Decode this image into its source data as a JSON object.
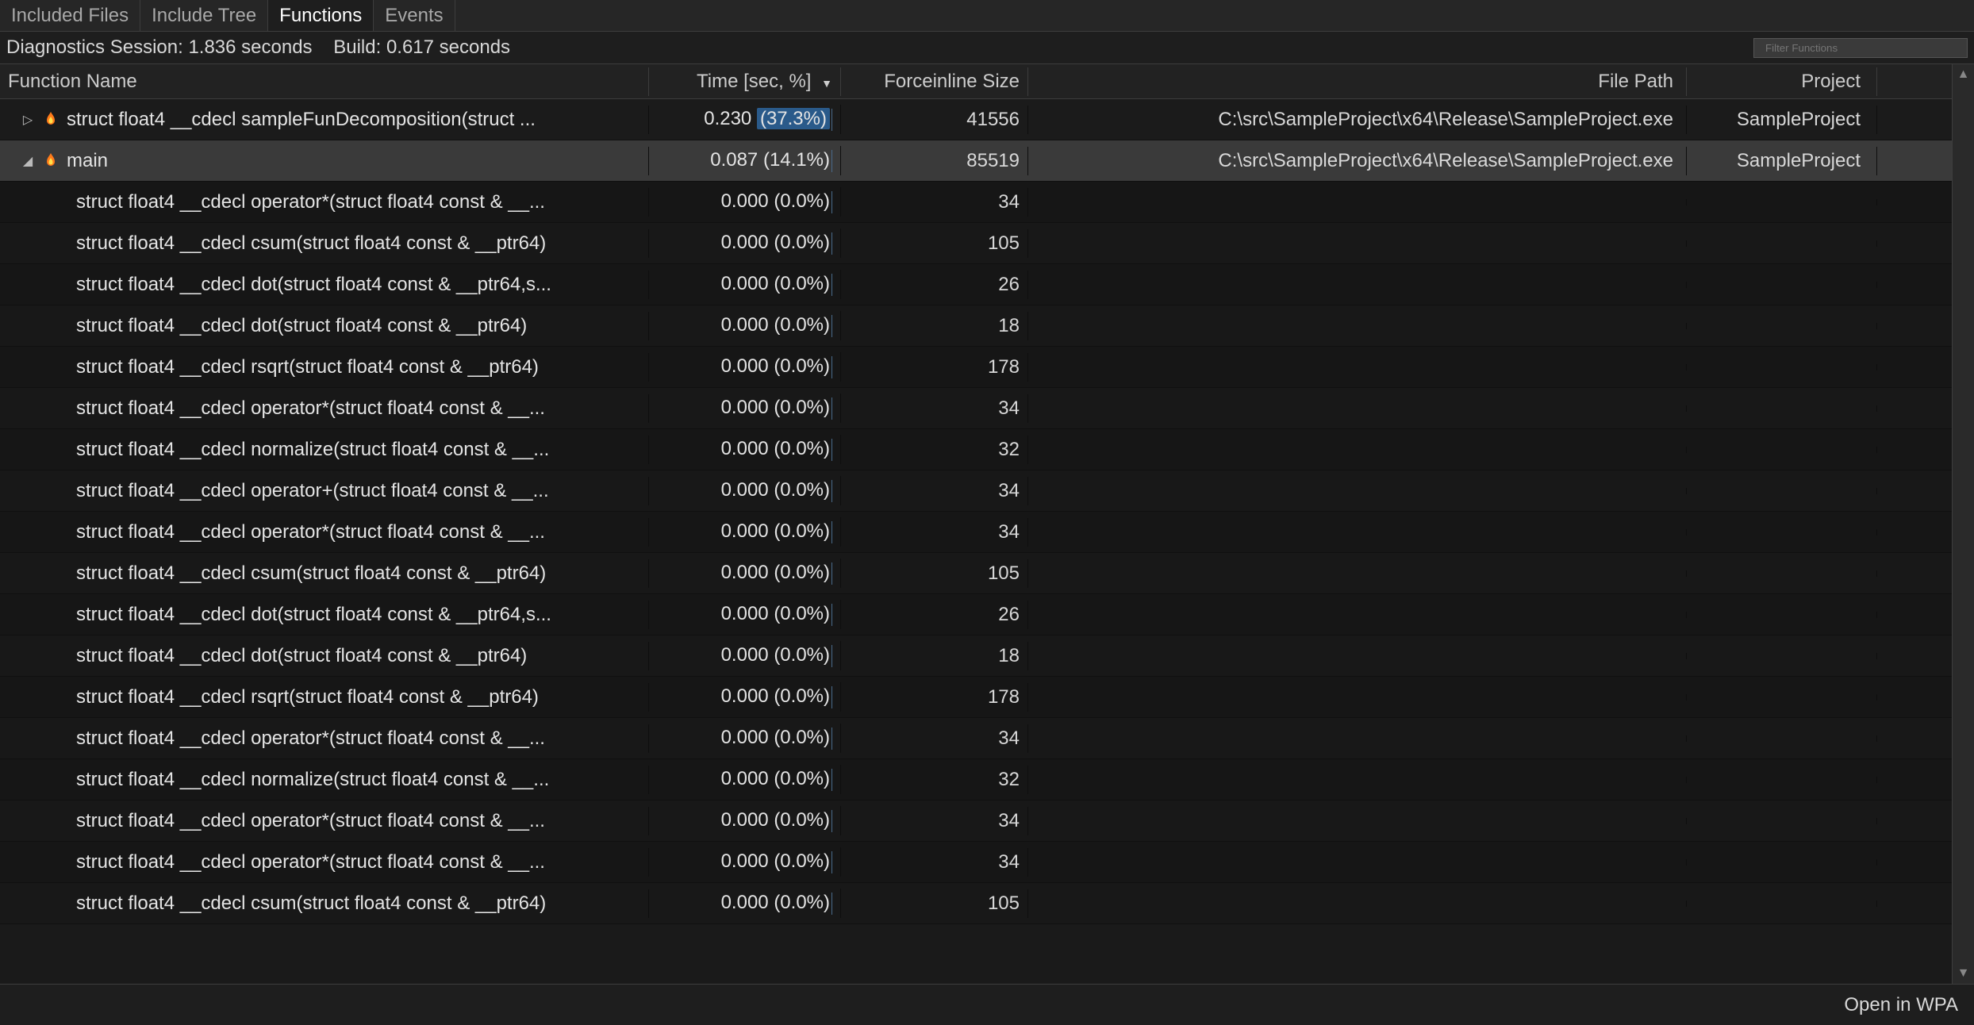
{
  "tabs": {
    "items": [
      {
        "label": "Included Files",
        "active": false
      },
      {
        "label": "Include Tree",
        "active": false
      },
      {
        "label": "Functions",
        "active": true
      },
      {
        "label": "Events",
        "active": false
      }
    ]
  },
  "infobar": {
    "session_label": "Diagnostics Session: 1.836 seconds",
    "build_label": "Build: 0.617 seconds",
    "filter_placeholder": "Filter Functions"
  },
  "columns": {
    "name": "Function Name",
    "time": "Time [sec, %]",
    "size": "Forceinline Size",
    "path": "File Path",
    "proj": "Project"
  },
  "rows": [
    {
      "level": 0,
      "expander": "▷",
      "flame": true,
      "name": "struct float4 __cdecl sampleFunDecomposition(struct ...",
      "time_sec": "0.230",
      "time_pct": "(37.3%)",
      "pct_hl": true,
      "size": "41556",
      "path": "C:\\src\\SampleProject\\x64\\Release\\SampleProject.exe",
      "project": "SampleProject"
    },
    {
      "level": 0,
      "expander": "◢",
      "flame": true,
      "selected": true,
      "name": "main",
      "time_sec": "0.087",
      "time_pct": "(14.1%)",
      "size": "85519",
      "path": "C:\\src\\SampleProject\\x64\\Release\\SampleProject.exe",
      "project": "SampleProject"
    },
    {
      "level": 1,
      "name": "struct float4 __cdecl operator*(struct float4 const & __...",
      "time_sec": "0.000",
      "time_pct": "(0.0%)",
      "size": "34",
      "path": "",
      "project": ""
    },
    {
      "level": 1,
      "name": "struct float4 __cdecl csum(struct float4 const & __ptr64)",
      "time_sec": "0.000",
      "time_pct": "(0.0%)",
      "size": "105",
      "path": "",
      "project": ""
    },
    {
      "level": 1,
      "name": "struct float4 __cdecl dot(struct float4 const & __ptr64,s...",
      "time_sec": "0.000",
      "time_pct": "(0.0%)",
      "size": "26",
      "path": "",
      "project": ""
    },
    {
      "level": 1,
      "name": "struct float4 __cdecl dot(struct float4 const & __ptr64)",
      "time_sec": "0.000",
      "time_pct": "(0.0%)",
      "size": "18",
      "path": "",
      "project": ""
    },
    {
      "level": 1,
      "name": "struct float4 __cdecl rsqrt(struct float4 const & __ptr64)",
      "time_sec": "0.000",
      "time_pct": "(0.0%)",
      "size": "178",
      "path": "",
      "project": ""
    },
    {
      "level": 1,
      "name": "struct float4 __cdecl operator*(struct float4 const & __...",
      "time_sec": "0.000",
      "time_pct": "(0.0%)",
      "size": "34",
      "path": "",
      "project": ""
    },
    {
      "level": 1,
      "name": "struct float4 __cdecl normalize(struct float4 const & __...",
      "time_sec": "0.000",
      "time_pct": "(0.0%)",
      "size": "32",
      "path": "",
      "project": ""
    },
    {
      "level": 1,
      "name": "struct float4 __cdecl operator+(struct float4 const & __...",
      "time_sec": "0.000",
      "time_pct": "(0.0%)",
      "size": "34",
      "path": "",
      "project": ""
    },
    {
      "level": 1,
      "name": "struct float4 __cdecl operator*(struct float4 const & __...",
      "time_sec": "0.000",
      "time_pct": "(0.0%)",
      "size": "34",
      "path": "",
      "project": ""
    },
    {
      "level": 1,
      "name": "struct float4 __cdecl csum(struct float4 const & __ptr64)",
      "time_sec": "0.000",
      "time_pct": "(0.0%)",
      "size": "105",
      "path": "",
      "project": ""
    },
    {
      "level": 1,
      "name": "struct float4 __cdecl dot(struct float4 const & __ptr64,s...",
      "time_sec": "0.000",
      "time_pct": "(0.0%)",
      "size": "26",
      "path": "",
      "project": ""
    },
    {
      "level": 1,
      "name": "struct float4 __cdecl dot(struct float4 const & __ptr64)",
      "time_sec": "0.000",
      "time_pct": "(0.0%)",
      "size": "18",
      "path": "",
      "project": ""
    },
    {
      "level": 1,
      "name": "struct float4 __cdecl rsqrt(struct float4 const & __ptr64)",
      "time_sec": "0.000",
      "time_pct": "(0.0%)",
      "size": "178",
      "path": "",
      "project": ""
    },
    {
      "level": 1,
      "name": "struct float4 __cdecl operator*(struct float4 const & __...",
      "time_sec": "0.000",
      "time_pct": "(0.0%)",
      "size": "34",
      "path": "",
      "project": ""
    },
    {
      "level": 1,
      "name": "struct float4 __cdecl normalize(struct float4 const & __...",
      "time_sec": "0.000",
      "time_pct": "(0.0%)",
      "size": "32",
      "path": "",
      "project": ""
    },
    {
      "level": 1,
      "name": "struct float4 __cdecl operator*(struct float4 const & __...",
      "time_sec": "0.000",
      "time_pct": "(0.0%)",
      "size": "34",
      "path": "",
      "project": ""
    },
    {
      "level": 1,
      "name": "struct float4 __cdecl operator*(struct float4 const & __...",
      "time_sec": "0.000",
      "time_pct": "(0.0%)",
      "size": "34",
      "path": "",
      "project": ""
    },
    {
      "level": 1,
      "name": "struct float4 __cdecl csum(struct float4 const & __ptr64)",
      "time_sec": "0.000",
      "time_pct": "(0.0%)",
      "size": "105",
      "path": "",
      "project": ""
    }
  ],
  "bottom": {
    "open_label": "Open in WPA"
  }
}
